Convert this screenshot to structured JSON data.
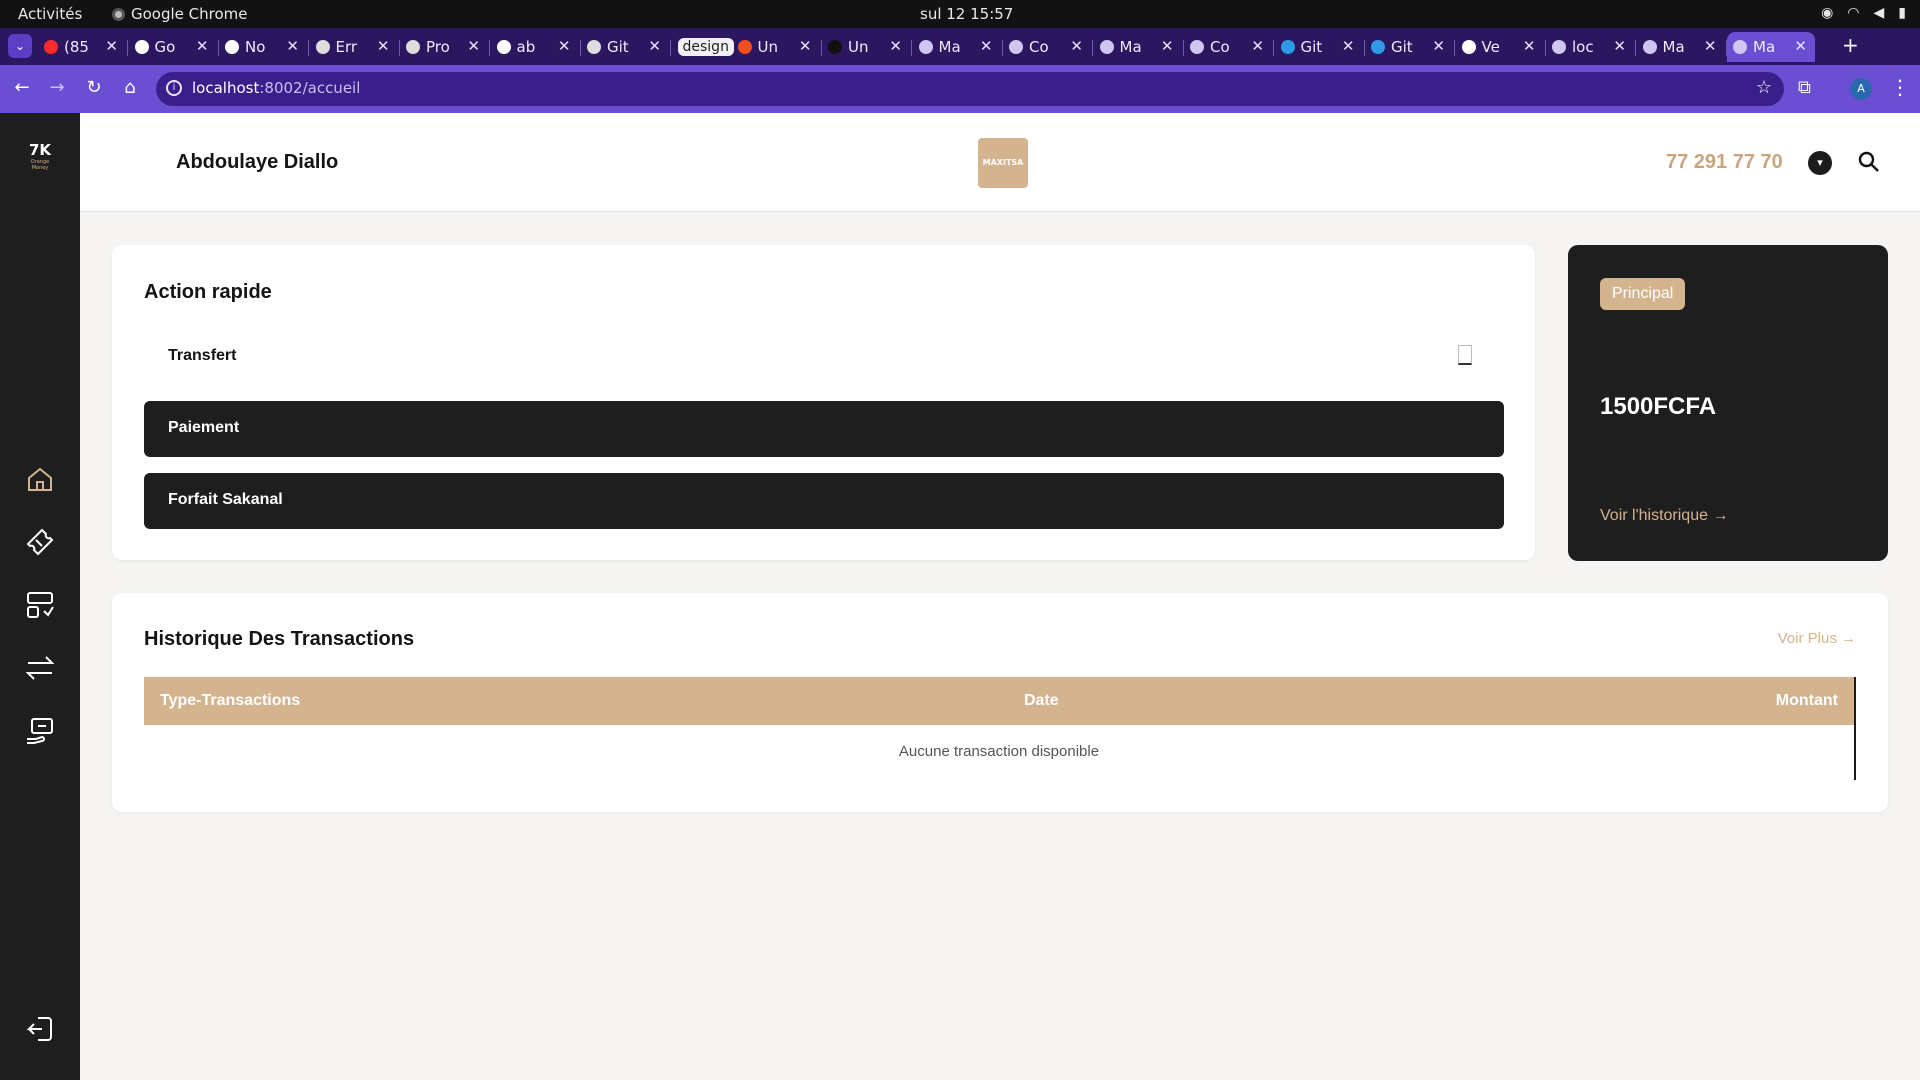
{
  "os": {
    "activities": "Activités",
    "app_name": "Google Chrome",
    "clock": "sul 12  15:57"
  },
  "browser": {
    "tabs": [
      {
        "title": "(85",
        "kind": "youtube"
      },
      {
        "title": "Go",
        "kind": "google"
      },
      {
        "title": "No",
        "kind": "notion"
      },
      {
        "title": "Err",
        "kind": "chatgpt"
      },
      {
        "title": "Pro",
        "kind": "chatgpt"
      },
      {
        "title": "ab",
        "kind": "github"
      },
      {
        "title": "Git",
        "kind": "chatgpt"
      },
      {
        "title": "Un",
        "kind": "figma",
        "group": "design"
      },
      {
        "title": "Un",
        "kind": "vercel"
      },
      {
        "title": "Ma",
        "kind": "web"
      },
      {
        "title": "Co",
        "kind": "web"
      },
      {
        "title": "Ma",
        "kind": "web"
      },
      {
        "title": "Co",
        "kind": "web"
      },
      {
        "title": "Git",
        "kind": "vscode"
      },
      {
        "title": "Git",
        "kind": "vscode"
      },
      {
        "title": "Ve",
        "kind": "github"
      },
      {
        "title": "loc",
        "kind": "web"
      },
      {
        "title": "Ma",
        "kind": "web"
      },
      {
        "title": "Ma",
        "kind": "web",
        "active": true
      }
    ],
    "url_host": "localhost",
    "url_path": ":8002/accueil",
    "profile_initial": "A"
  },
  "sidebar": {
    "logo_text": "7K",
    "logo_sub": "Orange Money",
    "items": [
      {
        "icon": "home-icon"
      },
      {
        "icon": "ticket-icon"
      },
      {
        "icon": "services-icon"
      },
      {
        "icon": "transfer-icon"
      },
      {
        "icon": "payment-icon"
      },
      {
        "icon": "logout-icon"
      }
    ]
  },
  "header": {
    "user_name": "Abdoulaye Diallo",
    "brand_logo_text": "MAXITSA",
    "phone": "77 291 77 70"
  },
  "quick_actions": {
    "title": "Action rapide",
    "items": [
      {
        "label": "Transfert",
        "style": "light"
      },
      {
        "label": "Paiement",
        "style": "dark"
      },
      {
        "label": "Forfait Sakanal",
        "style": "dark"
      }
    ]
  },
  "balance": {
    "badge": "Principal",
    "amount": "1500FCFA",
    "history_link": "Voir l'historique →"
  },
  "transactions": {
    "title": "Historique Des Transactions",
    "see_more": "Voir Plus →",
    "columns": [
      "Type-Transactions",
      "Date",
      "Montant"
    ],
    "empty_message": "Aucune transaction disponible"
  },
  "colors": {
    "accent": "#d4b48e",
    "dark": "#1e1e1e",
    "tab_bar": "#2b1660",
    "address_bar": "#6b4fd3"
  }
}
